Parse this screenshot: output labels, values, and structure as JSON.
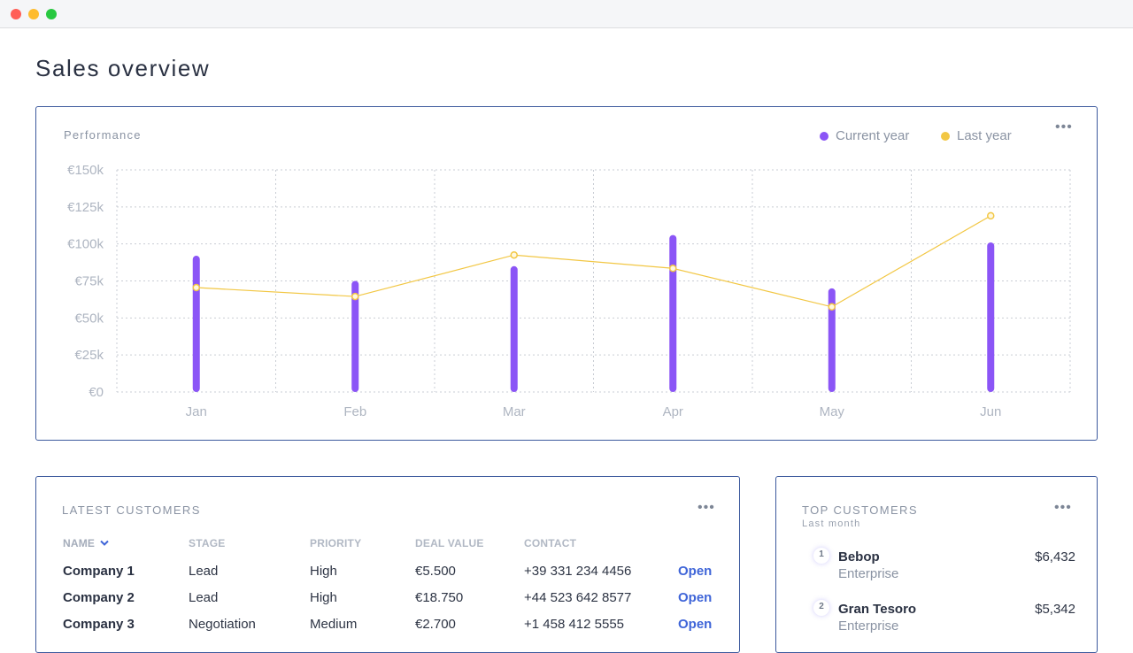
{
  "window": {
    "controls": [
      "close",
      "minimize",
      "maximize"
    ]
  },
  "page": {
    "title": "Sales overview"
  },
  "performance": {
    "label": "Performance",
    "legend": [
      {
        "name": "Current year",
        "color": "#8b55f6"
      },
      {
        "name": "Last year",
        "color": "#f2c744"
      }
    ],
    "more_label": "•••"
  },
  "chart_data": {
    "type": "bar",
    "title": "Performance",
    "categories": [
      "Jan",
      "Feb",
      "Mar",
      "Apr",
      "May",
      "Jun"
    ],
    "series": [
      {
        "name": "Current year",
        "type": "bar",
        "color": "#8b55f6",
        "values": [
          92000,
          75000,
          85000,
          106000,
          70000,
          101000
        ]
      },
      {
        "name": "Last year",
        "type": "line",
        "color": "#f2c744",
        "values": [
          70500,
          64500,
          92500,
          83500,
          57500,
          119000
        ]
      }
    ],
    "y_ticks": [
      0,
      25000,
      50000,
      75000,
      100000,
      125000,
      150000
    ],
    "y_tick_labels": [
      "€0",
      "€25k",
      "€50k",
      "€75k",
      "€100k",
      "€125k",
      "€150k"
    ],
    "ylim": [
      0,
      150000
    ],
    "xlabel": "",
    "ylabel": "",
    "grid": true,
    "legend_position": "top-right"
  },
  "latest_customers": {
    "title": "LATEST CUSTOMERS",
    "more_label": "•••",
    "columns": [
      "NAME",
      "STAGE",
      "PRIORITY",
      "DEAL VALUE",
      "CONTACT"
    ],
    "sorted_column": "NAME",
    "rows": [
      {
        "name": "Company 1",
        "stage": "Lead",
        "priority": "High",
        "deal_value": "€5.500",
        "contact": "+39 331 234 4456",
        "action": "Open"
      },
      {
        "name": "Company 2",
        "stage": "Lead",
        "priority": "High",
        "deal_value": "€18.750",
        "contact": "+44 523 642 8577",
        "action": "Open"
      },
      {
        "name": "Company 3",
        "stage": "Negotiation",
        "priority": "Medium",
        "deal_value": "€2.700",
        "contact": "+1 458 412 5555",
        "action": "Open"
      }
    ]
  },
  "top_customers": {
    "title": "TOP CUSTOMERS",
    "subtitle": "Last month",
    "more_label": "•••",
    "items": [
      {
        "rank": "1",
        "name": "Bebop",
        "type": "Enterprise",
        "value": "$6,432"
      },
      {
        "rank": "2",
        "name": "Gran Tesoro",
        "type": "Enterprise",
        "value": "$5,342"
      }
    ]
  }
}
